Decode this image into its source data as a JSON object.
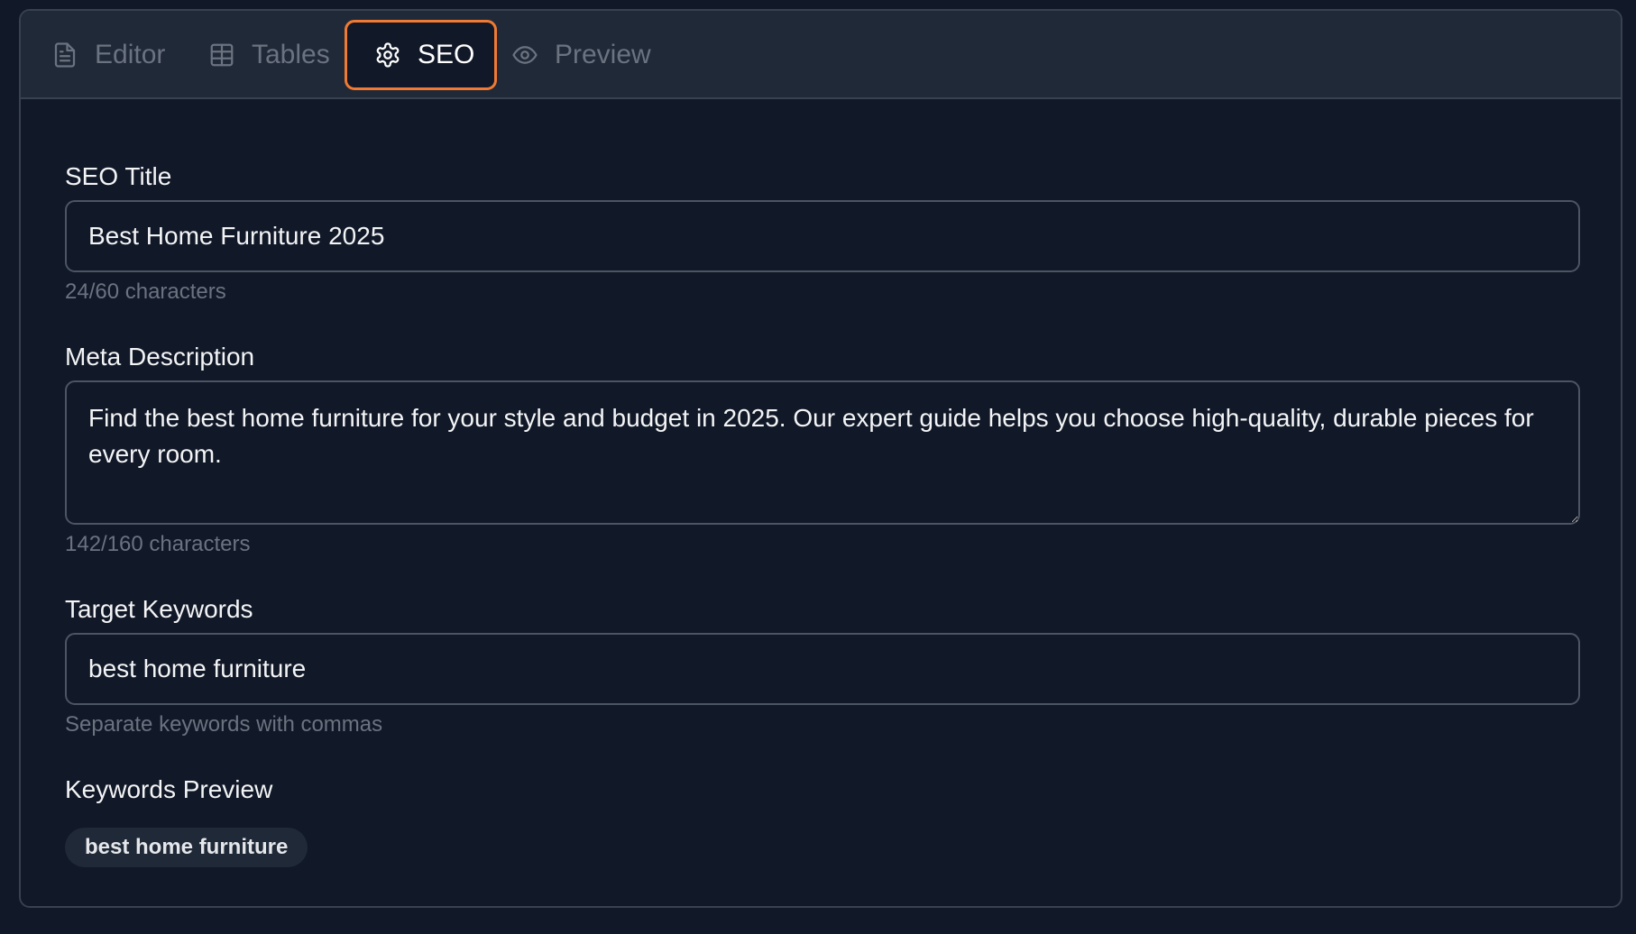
{
  "tabs": [
    {
      "label": "Editor",
      "icon": "file-text-icon"
    },
    {
      "label": "Tables",
      "icon": "table-icon"
    },
    {
      "label": "SEO",
      "icon": "gear-icon",
      "active": true
    },
    {
      "label": "Preview",
      "icon": "eye-icon"
    }
  ],
  "seo_title": {
    "label": "SEO Title",
    "value": "Best Home Furniture 2025",
    "help": "24/60 characters"
  },
  "meta_description": {
    "label": "Meta Description",
    "value": "Find the best home furniture for your style and budget in 2025. Our expert guide helps you choose high-quality, durable pieces for every room.",
    "help": "142/160 characters"
  },
  "target_keywords": {
    "label": "Target Keywords",
    "value": "best home furniture",
    "help": "Separate keywords with commas"
  },
  "keywords_preview": {
    "label": "Keywords Preview",
    "chips": [
      "best home furniture"
    ]
  },
  "colors": {
    "background": "#111827",
    "tab_bar": "#1f2937",
    "active_tab_border": "#f07a33",
    "muted_text": "#6b7280",
    "text": "#f3f4f6"
  }
}
